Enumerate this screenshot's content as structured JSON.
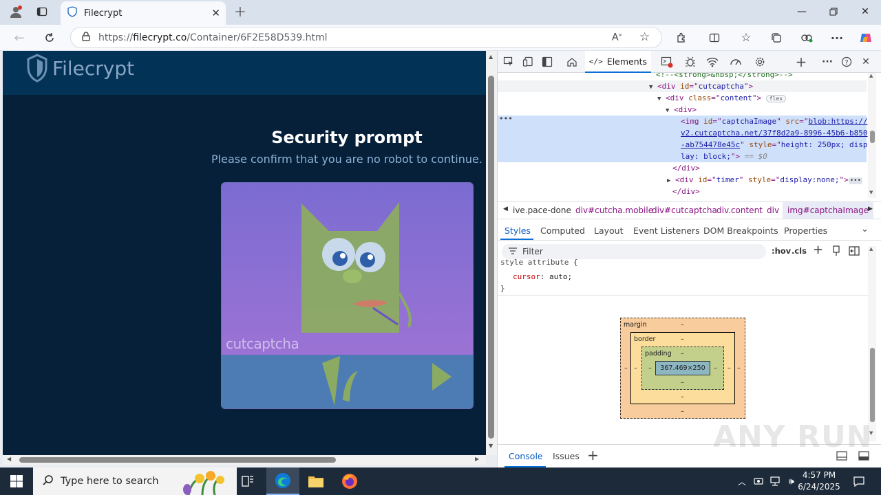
{
  "browser": {
    "tab_title": "Filecrypt",
    "url_prefix": "https://",
    "url_domain": "filecrypt.co",
    "url_path": "/Container/6F2E58D539.html"
  },
  "page": {
    "logo_text": "Filecrypt",
    "title": "Security prompt",
    "subtitle": "Please confirm that you are no robot to continue.",
    "captcha_brand": "cutcaptcha",
    "colors": {
      "header": "#033257",
      "background": "#062039",
      "captcha_bg": "#7e6fd0",
      "captcha_bottom": "#4b7cb4"
    }
  },
  "devtools": {
    "elements_tab": "Elements",
    "dom_lines": [
      {
        "indent": 230,
        "arrow": "",
        "parts": [
          [
            "cm",
            "<!--<strong>&nbsp;</strong>-->"
          ]
        ]
      },
      {
        "indent": 232,
        "arrow": "▼",
        "parts": [
          [
            "tg",
            "<div "
          ],
          [
            "an",
            "id"
          ],
          [
            "tg",
            "=\""
          ],
          [
            "av",
            "cutcaptcha"
          ],
          [
            "tg",
            "\">"
          ]
        ]
      },
      {
        "indent": 244,
        "arrow": "▼",
        "parts": [
          [
            "tg",
            "<div "
          ],
          [
            "an",
            "class"
          ],
          [
            "tg",
            "=\""
          ],
          [
            "av",
            "content"
          ],
          [
            "tg",
            "\">"
          ]
        ]
      },
      {
        "indent": 256,
        "arrow": "▼",
        "parts": [
          [
            "tg",
            "<div>"
          ]
        ]
      }
    ],
    "selected_lines": [
      "<img id=\"captchaImage\" src=\"blob:https://",
      "v2.cutcaptcha.net/37f8d2a9-8996-45b6-b850",
      "-ab754478e45c\" style=\"height: 250px; disp",
      "lay: block;\"> == $0"
    ],
    "after_lines": [
      {
        "indent": 254,
        "text": "</div>"
      },
      {
        "indent": 256,
        "text": "<div id=\"timer\" style=\"display:none;\">"
      },
      {
        "indent": 254,
        "text": "</div>"
      }
    ],
    "flex_badge": "flex",
    "breadcrumbs": [
      "ive.pace-done",
      "div#cutcha.mobile",
      "div#cutcaptcha",
      "div.content",
      "div",
      "img#captchaImage"
    ],
    "style_tabs": [
      "Styles",
      "Computed",
      "Layout",
      "Event Listeners",
      "DOM Breakpoints",
      "Properties"
    ],
    "filter_placeholder": "Filter",
    "hov": ":hov",
    "cls": ".cls",
    "style_selector": "style attribute {",
    "style_prop": "cursor",
    "style_val": "auto;",
    "style_close": "}",
    "box_model": {
      "margin": "margin",
      "border": "border",
      "padding": "padding",
      "content": "367.469×250",
      "dash": "–"
    },
    "bottom_tabs": [
      "Console",
      "Issues"
    ]
  },
  "taskbar": {
    "search_placeholder": "Type here to search",
    "time": "4:57 PM",
    "date": "6/24/2025"
  },
  "watermark": "ANY RUN"
}
